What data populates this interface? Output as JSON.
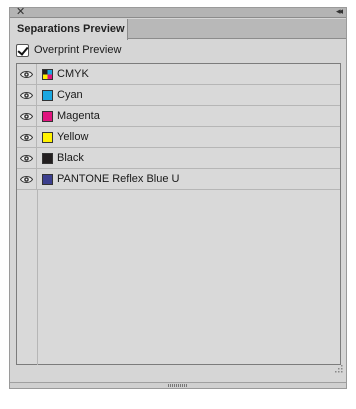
{
  "panel": {
    "tab_title": "Separations Preview",
    "close_glyph": "✕",
    "collapse_glyph": "◂◂"
  },
  "overprint": {
    "label": "Overprint Preview",
    "checked": true
  },
  "separations": [
    {
      "name": "CMYK",
      "swatch": "cmyk-composite",
      "visible": true
    },
    {
      "name": "Cyan",
      "swatch": "#1aa7e0",
      "visible": true
    },
    {
      "name": "Magenta",
      "swatch": "#e0157f",
      "visible": true
    },
    {
      "name": "Yellow",
      "swatch": "#fff200",
      "visible": true
    },
    {
      "name": "Black",
      "swatch": "#231f20",
      "visible": true
    },
    {
      "name": "PANTONE Reflex Blue U",
      "swatch": "#3c3f8e",
      "visible": true
    }
  ],
  "icons": {
    "visibility": "eye-icon",
    "close": "close-icon",
    "collapse": "double-chevron-left-icon",
    "resize": "resize-grip-icon",
    "drag": "drag-handle-icon"
  }
}
